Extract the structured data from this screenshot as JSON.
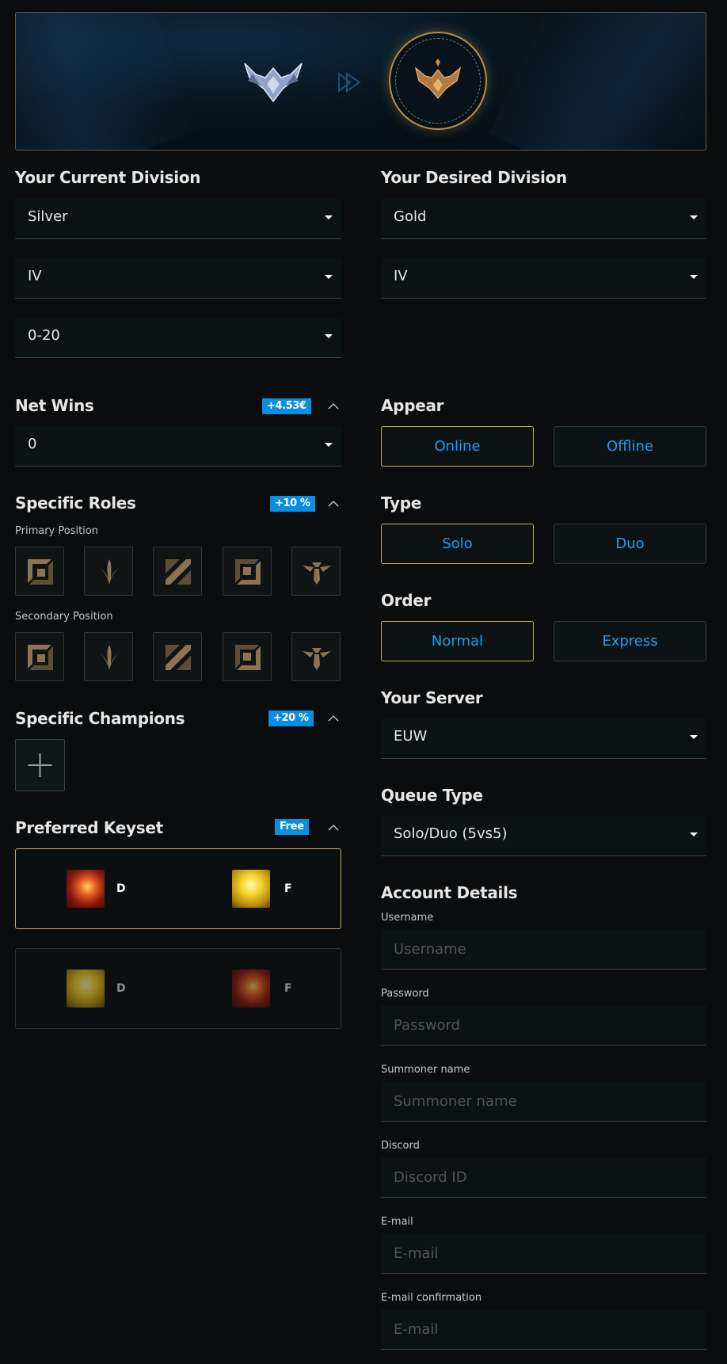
{
  "current_division": {
    "title": "Your Current Division",
    "tier": "Silver",
    "division": "IV",
    "lp": "0-20"
  },
  "desired_division": {
    "title": "Your Desired Division",
    "tier": "Gold",
    "division": "IV"
  },
  "net_wins": {
    "title": "Net Wins",
    "badge": "+4.53€",
    "value": "0"
  },
  "specific_roles": {
    "title": "Specific Roles",
    "badge": "+10 %",
    "primary_label": "Primary Position",
    "secondary_label": "Secondary Position",
    "roles": [
      "top-role-icon",
      "jungle-role-icon",
      "mid-role-icon",
      "bot-role-icon",
      "support-role-icon"
    ]
  },
  "specific_champions": {
    "title": "Specific Champions",
    "badge": "+20 %"
  },
  "preferred_keyset": {
    "title": "Preferred Keyset",
    "badge": "Free",
    "options": [
      {
        "first_spell": "ignite",
        "first_key": "D",
        "second_spell": "flash",
        "second_key": "F"
      },
      {
        "first_spell": "flash",
        "first_key": "D",
        "second_spell": "ignite",
        "second_key": "F"
      }
    ]
  },
  "appear": {
    "title": "Appear",
    "options": [
      "Online",
      "Offline"
    ],
    "selected": "Online"
  },
  "type": {
    "title": "Type",
    "options": [
      "Solo",
      "Duo"
    ],
    "selected": "Solo"
  },
  "order": {
    "title": "Order",
    "options": [
      "Normal",
      "Express"
    ],
    "selected": "Normal"
  },
  "server": {
    "title": "Your Server",
    "value": "EUW"
  },
  "queue": {
    "title": "Queue Type",
    "value": "Solo/Duo (5vs5)"
  },
  "account": {
    "title": "Account Details",
    "fields": [
      {
        "label": "Username",
        "placeholder": "Username"
      },
      {
        "label": "Password",
        "placeholder": "Password"
      },
      {
        "label": "Summoner name",
        "placeholder": "Summoner name"
      },
      {
        "label": "Discord",
        "placeholder": "Discord ID"
      },
      {
        "label": "E-mail",
        "placeholder": "E-mail"
      },
      {
        "label": "E-mail confirmation",
        "placeholder": "E-mail"
      }
    ]
  },
  "colors": {
    "accent_blue": "#0a8ee0",
    "gold_border": "#c9a86a",
    "background": "#0a0c0e"
  }
}
